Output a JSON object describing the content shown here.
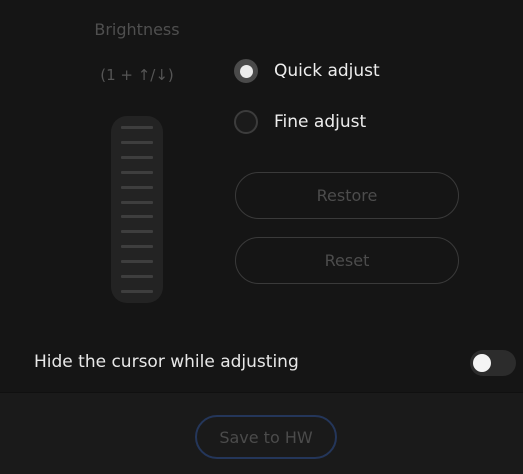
{
  "brightness": {
    "title": "Brightness",
    "hint": "(1 + ↑/↓)",
    "slider_ticks": 12
  },
  "adjust_mode": {
    "options": [
      {
        "label": "Quick adjust",
        "selected": true
      },
      {
        "label": "Fine adjust",
        "selected": false
      }
    ]
  },
  "buttons": {
    "restore_label": "Restore",
    "reset_label": "Reset",
    "save_label": "Save to HW"
  },
  "cursor_option": {
    "label": "Hide the cursor while adjusting",
    "enabled": false
  },
  "colors": {
    "background": "#151515",
    "save_border": "#24365a",
    "text": "#ededed"
  }
}
